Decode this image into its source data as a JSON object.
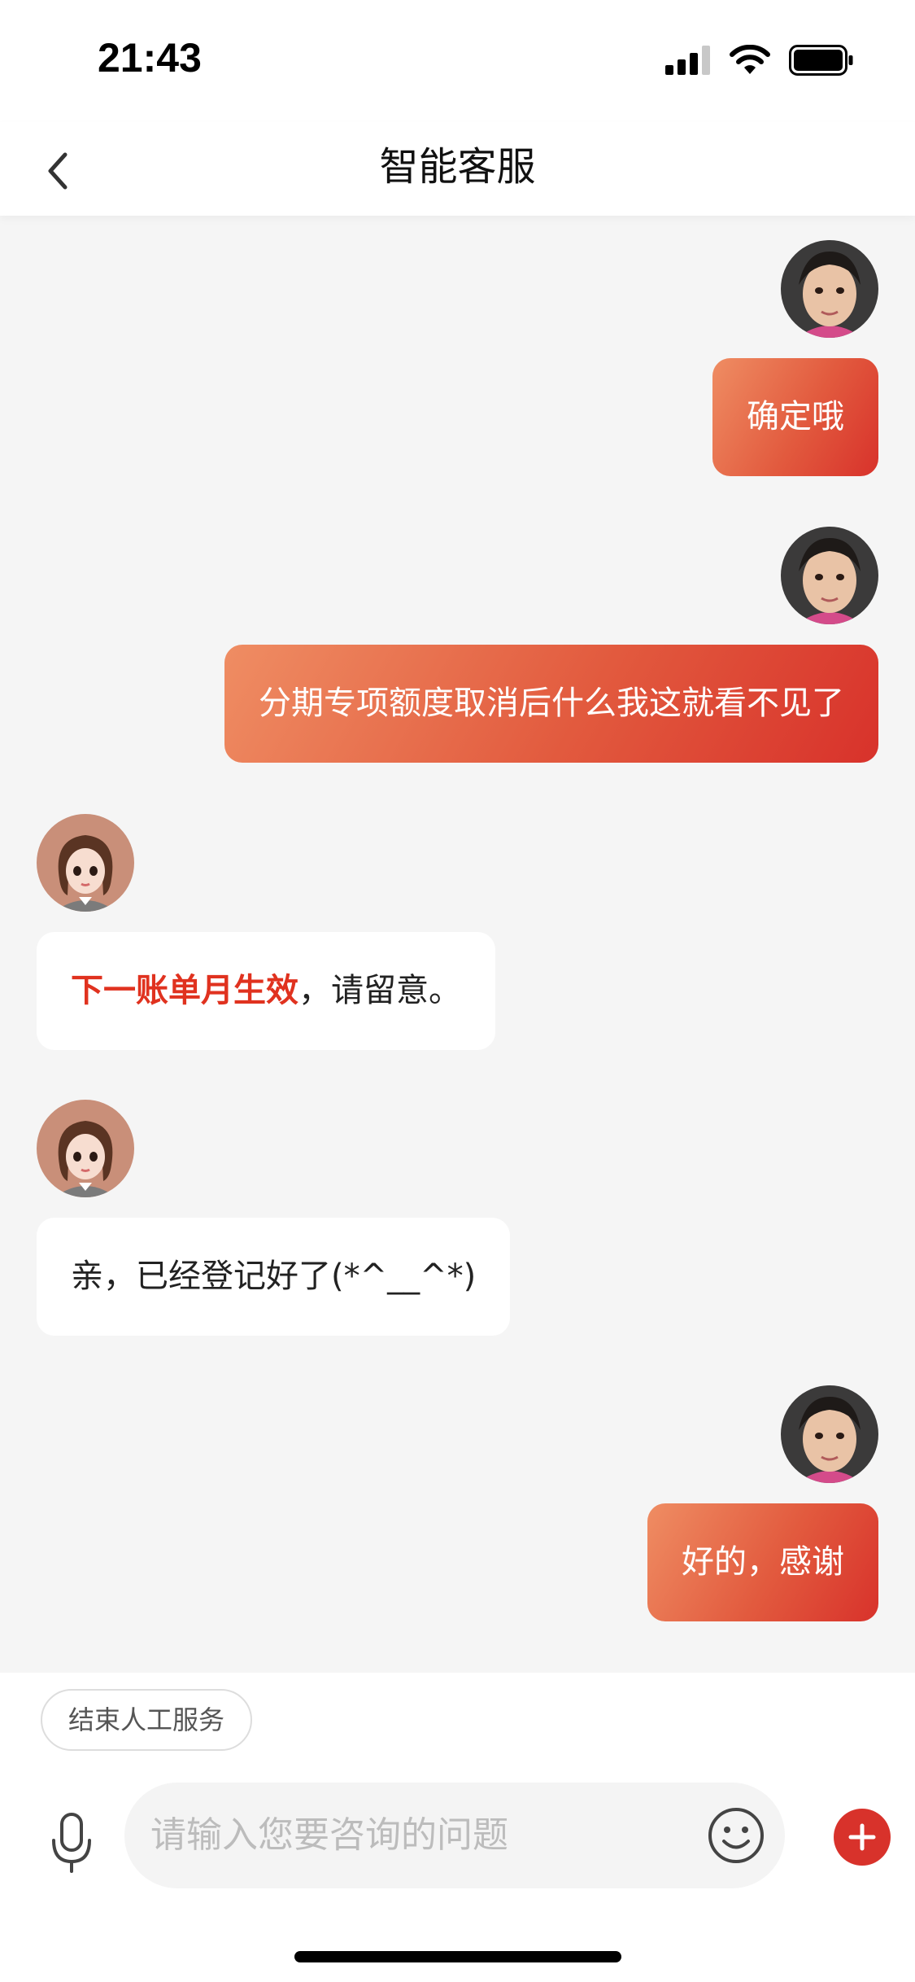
{
  "status_bar": {
    "time": "21:43"
  },
  "nav": {
    "title": "智能客服",
    "back_icon": "chevron-left-icon"
  },
  "messages": [
    {
      "sender": "user",
      "text": "确定哦"
    },
    {
      "sender": "user",
      "text": "分期专项额度取消后什么我这就看不见了"
    },
    {
      "sender": "agent",
      "highlight": "下一账单月生效",
      "text": "，请留意。"
    },
    {
      "sender": "agent",
      "text": "亲，已经登记好了(*^__^*)"
    },
    {
      "sender": "user",
      "text": "好的，感谢"
    }
  ],
  "bottom": {
    "end_service_label": "结束人工服务",
    "input_placeholder": "请输入您要咨询的问题",
    "mic_icon": "microphone-icon",
    "emoji_icon": "smiley-icon",
    "plus_icon": "plus-icon"
  },
  "colors": {
    "user_bubble_start": "#ef8d63",
    "user_bubble_end": "#d8322b",
    "highlight": "#e0321f",
    "plus_button": "#d8322b"
  }
}
